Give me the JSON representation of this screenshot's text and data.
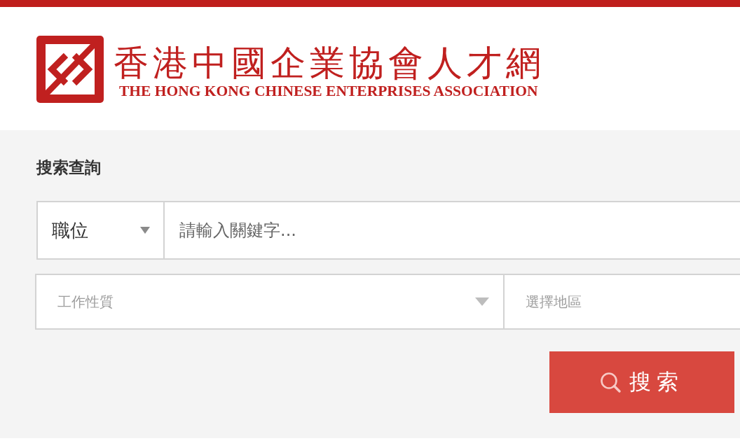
{
  "header": {
    "logo": {
      "title": "香港中國企業協會人才網",
      "subtitle": "THE HONG KONG CHINESE ENTERPRISES ASSOCIATION"
    }
  },
  "search": {
    "heading": "搜索查詢",
    "category_select": {
      "value": "職位"
    },
    "keyword_field": {
      "placeholder": "請輸入關鍵字..."
    },
    "job_type_select": {
      "placeholder": "工作性質"
    },
    "region_select": {
      "placeholder": "選擇地區"
    },
    "search_button": {
      "label": "搜索"
    }
  }
}
